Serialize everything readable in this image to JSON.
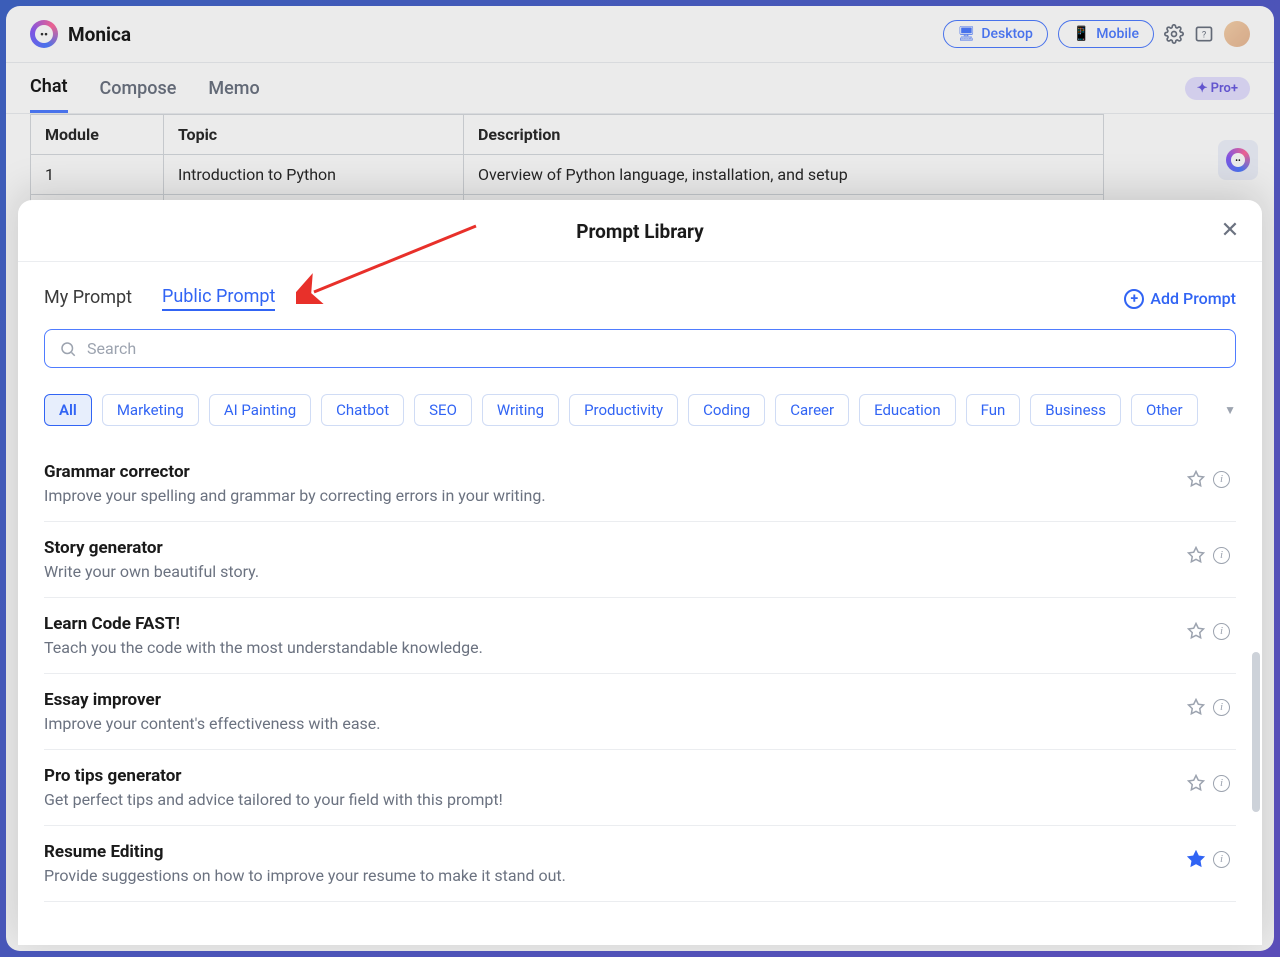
{
  "header": {
    "app_name": "Monica",
    "desktop_label": "Desktop",
    "mobile_label": "Mobile"
  },
  "main_tabs": {
    "chat": "Chat",
    "compose": "Compose",
    "memo": "Memo",
    "pro_label": "Pro+"
  },
  "bg_table": {
    "h1": "Module",
    "h2": "Topic",
    "h3": "Description",
    "r1c1": "1",
    "r1c2": "Introduction to Python",
    "r1c3": "Overview of Python language, installation, and setup"
  },
  "modal": {
    "title": "Prompt Library",
    "tab_my": "My Prompt",
    "tab_public": "Public Prompt",
    "add_prompt": "Add Prompt",
    "search_placeholder": "Search"
  },
  "filters": {
    "all": "All",
    "marketing": "Marketing",
    "ai_painting": "AI Painting",
    "chatbot": "Chatbot",
    "seo": "SEO",
    "writing": "Writing",
    "productivity": "Productivity",
    "coding": "Coding",
    "career": "Career",
    "education": "Education",
    "fun": "Fun",
    "business": "Business",
    "other": "Other"
  },
  "prompts": [
    {
      "title": "Grammar corrector",
      "desc": "Improve your spelling and grammar by correcting errors in your writing.",
      "starred": false
    },
    {
      "title": "Story generator",
      "desc": "Write your own beautiful story.",
      "starred": false
    },
    {
      "title": "Learn Code FAST!",
      "desc": "Teach you the code with the most understandable knowledge.",
      "starred": false
    },
    {
      "title": "Essay improver",
      "desc": "Improve your content's effectiveness with ease.",
      "starred": false
    },
    {
      "title": "Pro tips generator",
      "desc": "Get perfect tips and advice tailored to your field with this prompt!",
      "starred": false
    },
    {
      "title": "Resume Editing",
      "desc": "Provide suggestions on how to improve your resume to make it stand out.",
      "starred": true
    }
  ]
}
